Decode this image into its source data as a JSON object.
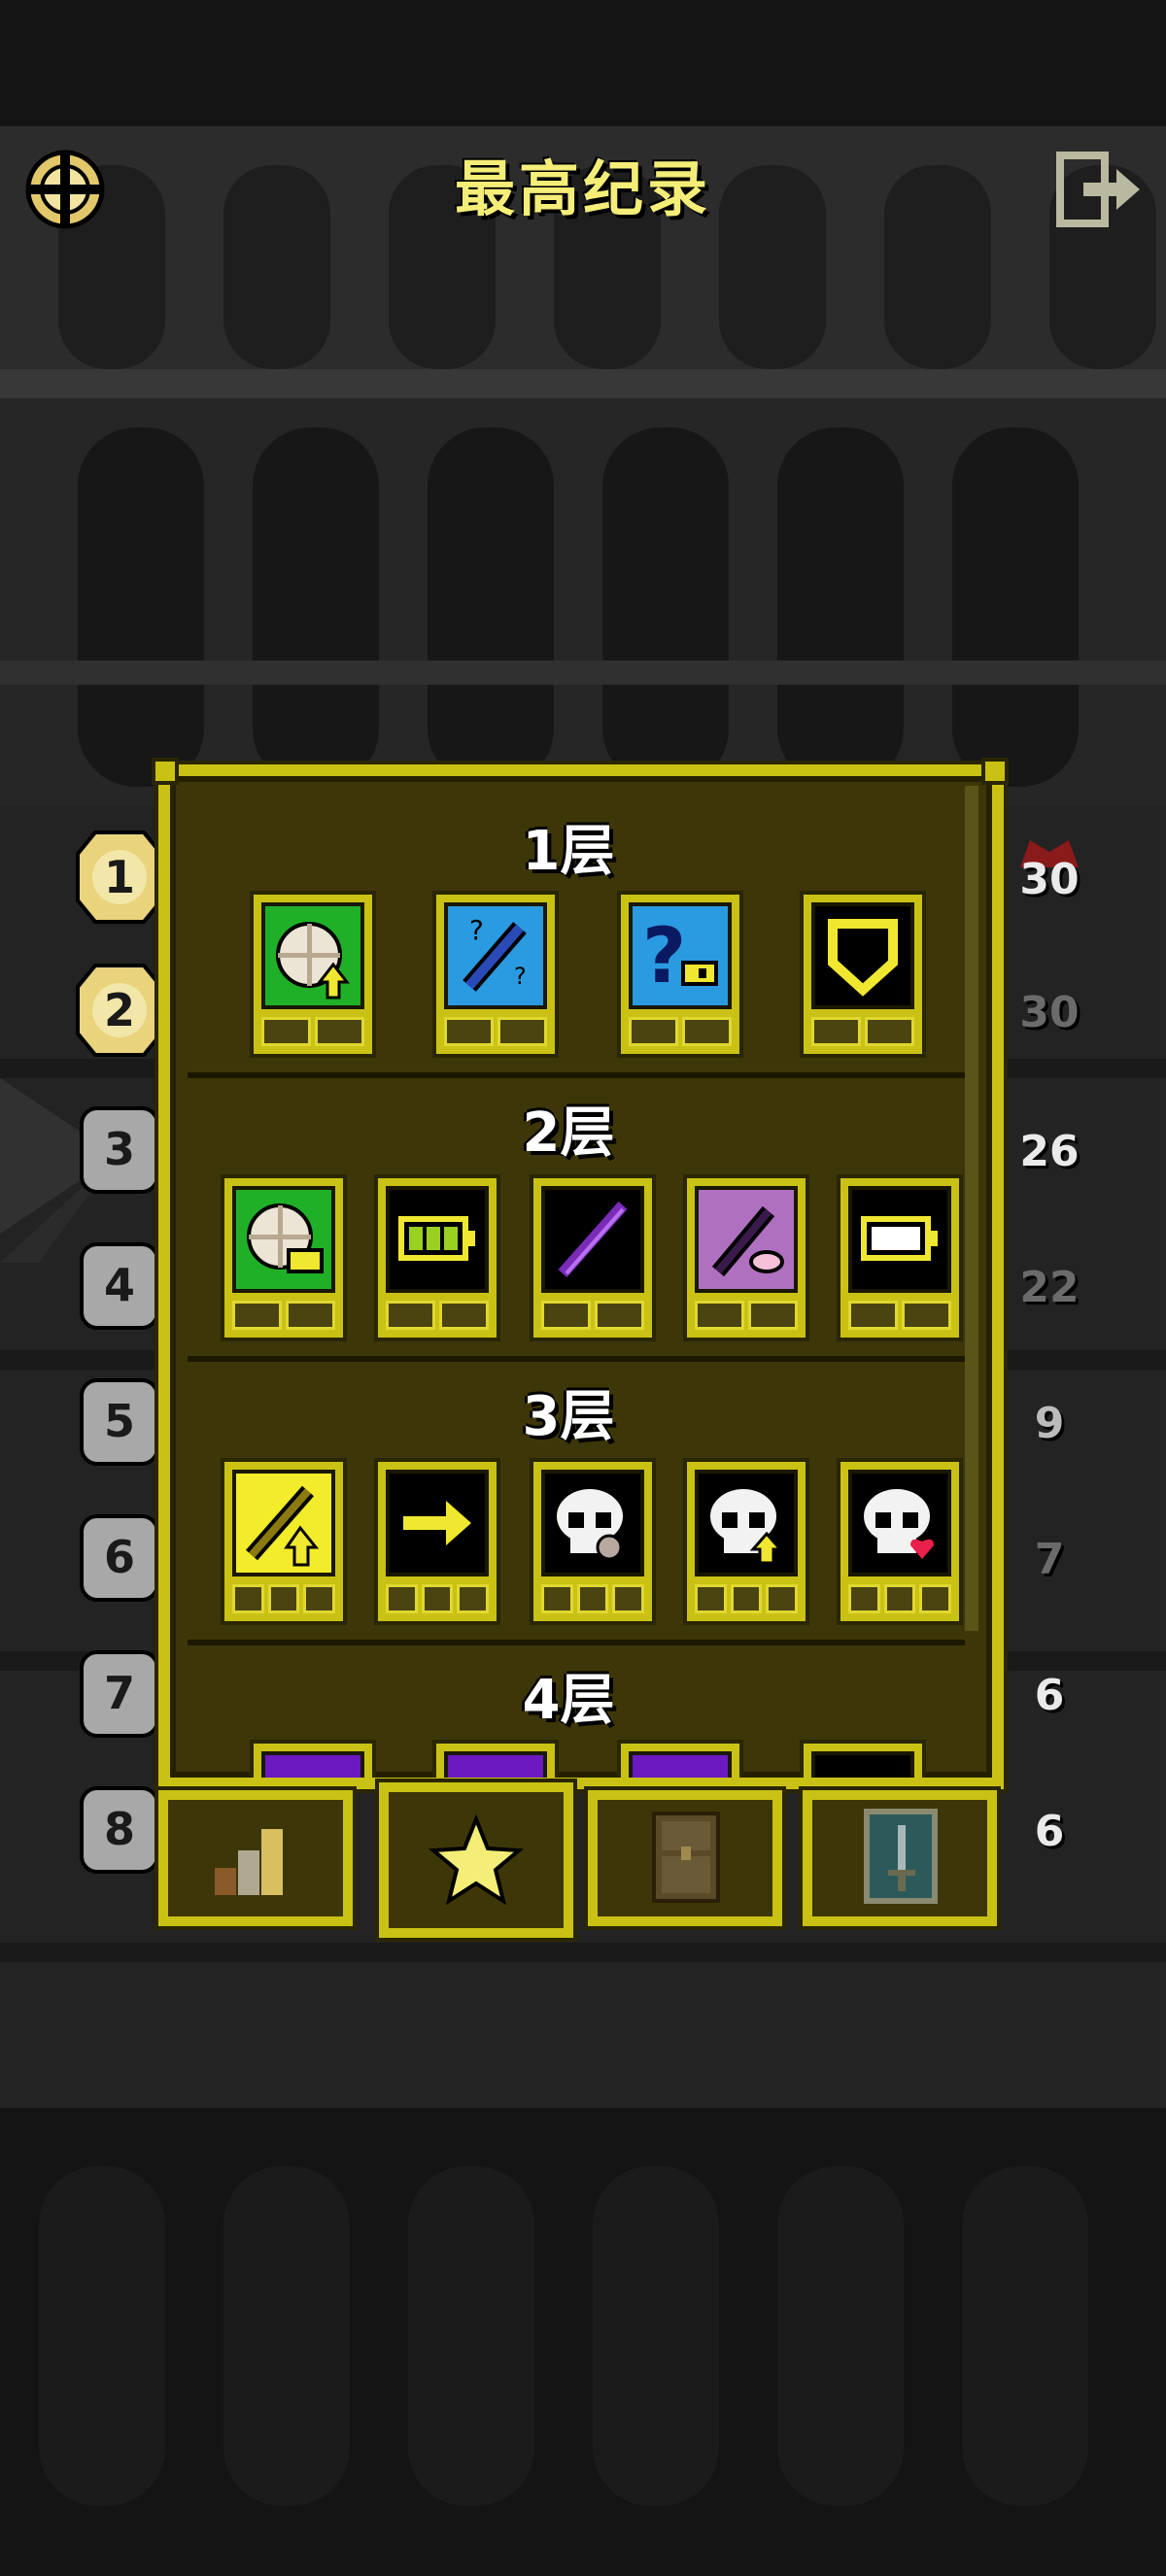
{
  "header": {
    "title": "最高纪录",
    "menu_icon": "compass-menu-icon",
    "exit_icon": "exit-icon"
  },
  "rankings": {
    "left": [
      "1",
      "2",
      "3",
      "4",
      "5",
      "6",
      "7",
      "8"
    ],
    "right": [
      "30",
      "30",
      "26",
      "22",
      "9",
      "7",
      "6",
      "6"
    ]
  },
  "dialog": {
    "floors": [
      {
        "label": "1层",
        "badges": [
          "gold-plus-badge",
          "blue-wand-badge",
          "blue-mystery-key-badge",
          "shield-badge"
        ]
      },
      {
        "label": "2层",
        "badges": [
          "green-key-badge",
          "battery-full-badge",
          "purple-staff-badge",
          "pink-wand-badge",
          "battery-badge"
        ]
      },
      {
        "label": "3层",
        "badges": [
          "yellow-wand-up-badge",
          "arrow-right-badge",
          "skull-plus-badge",
          "skull-up-badge",
          "skull-heart-badge"
        ]
      },
      {
        "label": "4层",
        "badges": [
          "purple-badge",
          "purple-badge",
          "purple-badge",
          "yellow-badge"
        ]
      }
    ]
  },
  "tabs": [
    {
      "name": "stats-tab",
      "icon": "bar-chart-icon"
    },
    {
      "name": "badges-tab",
      "icon": "star-icon",
      "active": true
    },
    {
      "name": "journal-tab",
      "icon": "book-icon"
    },
    {
      "name": "quests-tab",
      "icon": "sword-card-icon"
    }
  ],
  "colors": {
    "accent": "#c9c214",
    "panel": "#3d3608",
    "title": "#f4ee78"
  }
}
